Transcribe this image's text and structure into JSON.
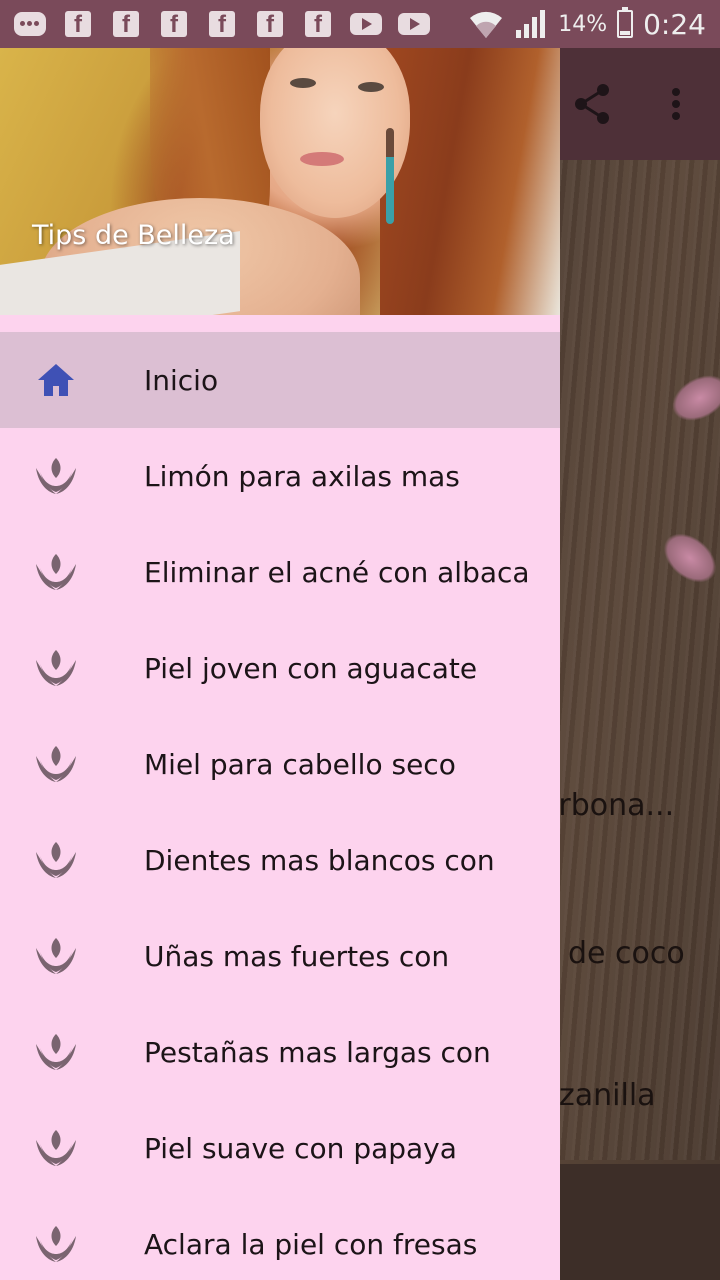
{
  "status_bar": {
    "notification_icons": [
      "message-icon",
      "facebook-icon",
      "facebook-icon",
      "facebook-icon",
      "facebook-icon",
      "facebook-icon",
      "facebook-icon",
      "youtube-icon",
      "youtube-icon"
    ],
    "battery_percent": "14%",
    "time": "0:24"
  },
  "app": {
    "toolbar_icons": [
      "share-icon",
      "more-vert-icon"
    ],
    "partial_texts": [
      "arbona...",
      "e de coco",
      "nzanilla"
    ]
  },
  "drawer": {
    "header_title": "Tips de Belleza",
    "items": [
      {
        "label": "Inicio",
        "icon": "home-icon",
        "active": true
      },
      {
        "label": "Limón para axilas mas",
        "icon": "lotus-icon",
        "active": false
      },
      {
        "label": "Eliminar el acné con albaca",
        "icon": "lotus-icon",
        "active": false
      },
      {
        "label": "Piel joven con aguacate",
        "icon": "lotus-icon",
        "active": false
      },
      {
        "label": "Miel para cabello seco",
        "icon": "lotus-icon",
        "active": false
      },
      {
        "label": "Dientes mas blancos con",
        "icon": "lotus-icon",
        "active": false
      },
      {
        "label": "Uñas mas fuertes con",
        "icon": "lotus-icon",
        "active": false
      },
      {
        "label": "Pestañas mas largas con",
        "icon": "lotus-icon",
        "active": false
      },
      {
        "label": "Piel suave con papaya",
        "icon": "lotus-icon",
        "active": false
      },
      {
        "label": "Aclara la piel con fresas",
        "icon": "lotus-icon",
        "active": false
      }
    ]
  },
  "colors": {
    "status_bar": "#7a4a5a",
    "drawer_bg": "#fdd3ee",
    "active_item_bg": "#dcbfd3",
    "home_icon": "#3f51b5",
    "lotus_icon": "#7a6470"
  }
}
